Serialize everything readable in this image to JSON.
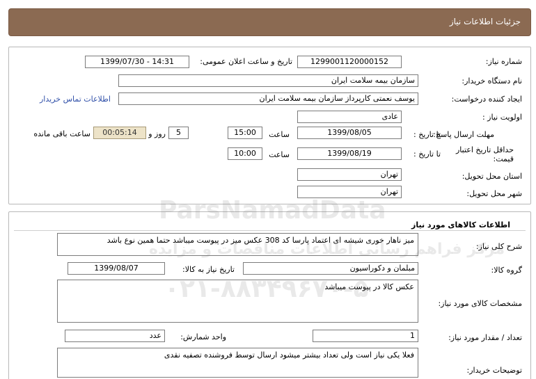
{
  "header": {
    "title": "جزئیات اطلاعات نیاز"
  },
  "info": {
    "need_number_label": "شماره نیاز:",
    "need_number": "1299001120000152",
    "announce_label": "تاریخ و ساعت اعلان عمومی:",
    "announce_value": "1399/07/30 - 14:31",
    "buyer_org_label": "نام دستگاه خریدار:",
    "buyer_org": "سازمان بیمه سلامت ایران",
    "requester_label": "ایجاد کننده درخواست:",
    "requester": "یوسف نعمتی کارپرداز سازمان بیمه سلامت ایران",
    "contact_link": "اطلاعات تماس خریدار",
    "priority_label": "اولویت نیاز :",
    "priority": "عادی",
    "deadline_label": "مهلت ارسال پاسخ:",
    "to_date_label": "تا تاریخ :",
    "deadline_date": "1399/08/05",
    "time_label": "ساعت",
    "deadline_time": "15:00",
    "days_value": "5",
    "days_label": "روز و",
    "remaining_time": "00:05:14",
    "remaining_label": "ساعت باقی مانده",
    "validity_label": "حداقل تاریخ اعتبار قیمت:",
    "validity_date": "1399/08/19",
    "validity_time": "10:00",
    "province_label": "استان محل تحویل:",
    "province": "تهران",
    "city_label": "شهر محل تحویل:",
    "city": "تهران"
  },
  "goods": {
    "section_title": "اطلاعات کالاهای مورد نیاز",
    "desc_label": "شرح کلی نیاز:",
    "desc": "میز ناهار خوری شیشه ای اعتماد پارسا کد 308 عکس میز در پیوست میباشد حتما همین نوع باشد",
    "group_label": "گروه کالا:",
    "group": "مبلمان و دکوراسیون",
    "need_date_label": "تاریخ نیاز به کالا:",
    "need_date": "1399/08/07",
    "spec_label": "مشخصات کالای مورد نیاز:",
    "spec": "عکس کالا در پیوست میباشد",
    "qty_label": "تعداد / مقدار مورد نیاز:",
    "qty": "1",
    "unit_label": "واحد شمارش:",
    "unit": "عدد",
    "buyer_notes_label": "توضیحات خریدار:",
    "buyer_notes": "فعلا یکی نیاز است ولی تعداد بیشتر میشود ارسال توسط فروشنده تصفیه نقدی"
  },
  "watermark": {
    "brand": "ParsNamadData",
    "line1": "مرکز فراهم رسانی اطلاعات مناقصات و مزایده",
    "phone": "۰۲۱-۸۸۳۴۹۶۷۰-۵"
  }
}
